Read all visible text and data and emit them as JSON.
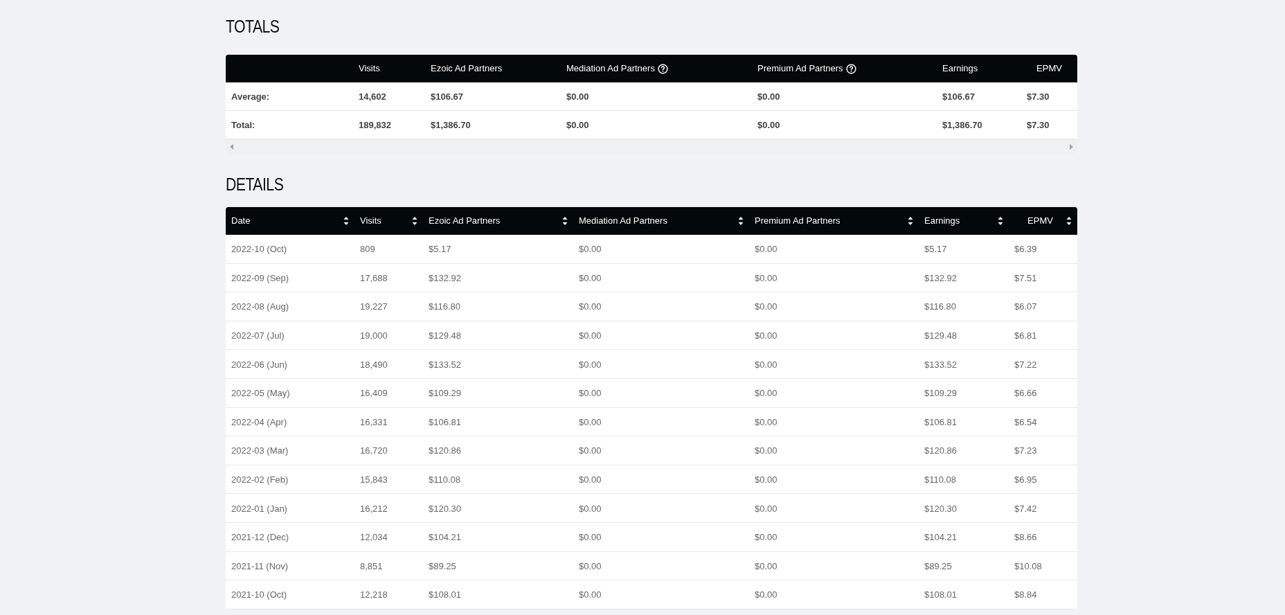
{
  "totals": {
    "title": "TOTALS",
    "columns": [
      {
        "label": "Visits",
        "help": false
      },
      {
        "label": "Ezoic Ad Partners",
        "help": false
      },
      {
        "label": "Mediation Ad Partners",
        "help": true
      },
      {
        "label": "Premium Ad Partners",
        "help": true
      },
      {
        "label": "Earnings",
        "help": false
      },
      {
        "label": "EPMV",
        "help": false
      }
    ],
    "rows": [
      {
        "label": "Average:",
        "cells": [
          "14,602",
          "$106.67",
          "$0.00",
          "$0.00",
          "$106.67",
          "$7.30"
        ]
      },
      {
        "label": "Total:",
        "cells": [
          "189,832",
          "$1,386.70",
          "$0.00",
          "$0.00",
          "$1,386.70",
          "$7.30"
        ]
      }
    ]
  },
  "details": {
    "title": "DETAILS",
    "columns": [
      "Date",
      "Visits",
      "Ezoic Ad Partners",
      "Mediation Ad Partners",
      "Premium Ad Partners",
      "Earnings",
      "EPMV"
    ],
    "rows": [
      [
        "2022-10 (Oct)",
        "809",
        "$5.17",
        "$0.00",
        "$0.00",
        "$5.17",
        "$6.39"
      ],
      [
        "2022-09 (Sep)",
        "17,688",
        "$132.92",
        "$0.00",
        "$0.00",
        "$132.92",
        "$7.51"
      ],
      [
        "2022-08 (Aug)",
        "19,227",
        "$116.80",
        "$0.00",
        "$0.00",
        "$116.80",
        "$6.07"
      ],
      [
        "2022-07 (Jul)",
        "19,000",
        "$129.48",
        "$0.00",
        "$0.00",
        "$129.48",
        "$6.81"
      ],
      [
        "2022-06 (Jun)",
        "18,490",
        "$133.52",
        "$0.00",
        "$0.00",
        "$133.52",
        "$7.22"
      ],
      [
        "2022-05 (May)",
        "16,409",
        "$109.29",
        "$0.00",
        "$0.00",
        "$109.29",
        "$6.66"
      ],
      [
        "2022-04 (Apr)",
        "16,331",
        "$106.81",
        "$0.00",
        "$0.00",
        "$106.81",
        "$6.54"
      ],
      [
        "2022-03 (Mar)",
        "16,720",
        "$120.86",
        "$0.00",
        "$0.00",
        "$120.86",
        "$7.23"
      ],
      [
        "2022-02 (Feb)",
        "15,843",
        "$110.08",
        "$0.00",
        "$0.00",
        "$110.08",
        "$6.95"
      ],
      [
        "2022-01 (Jan)",
        "16,212",
        "$120.30",
        "$0.00",
        "$0.00",
        "$120.30",
        "$7.42"
      ],
      [
        "2021-12 (Dec)",
        "12,034",
        "$104.21",
        "$0.00",
        "$0.00",
        "$104.21",
        "$8.66"
      ],
      [
        "2021-11 (Nov)",
        "8,851",
        "$89.25",
        "$0.00",
        "$0.00",
        "$89.25",
        "$10.08"
      ],
      [
        "2021-10 (Oct)",
        "12,218",
        "$108.01",
        "$0.00",
        "$0.00",
        "$108.01",
        "$8.84"
      ]
    ]
  }
}
